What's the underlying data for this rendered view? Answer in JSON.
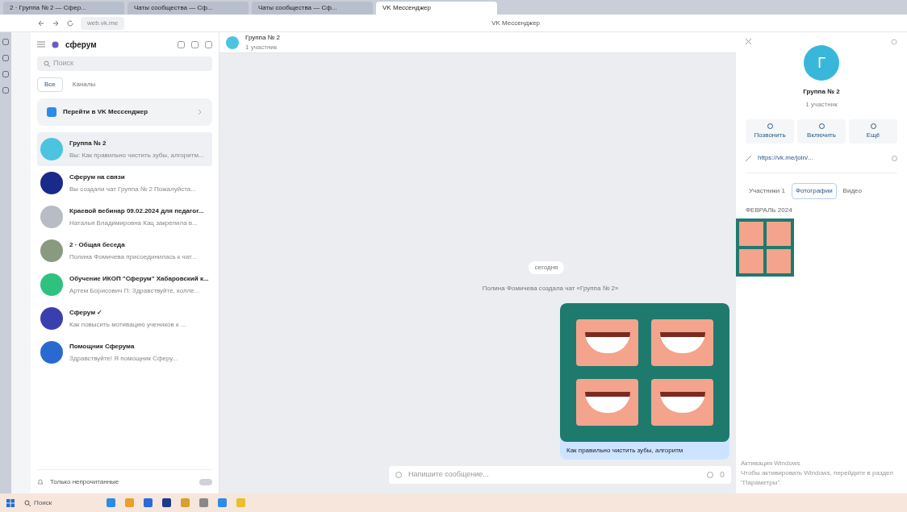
{
  "browser": {
    "tabs": [
      {
        "label": "2 · Группа № 2 — Сфер...",
        "selected": false
      },
      {
        "label": "Чаты сообщества — Сф...",
        "selected": false
      },
      {
        "label": "Чаты сообщества — Сф...",
        "selected": false
      },
      {
        "label": "VK Мессенджер",
        "selected": true
      }
    ],
    "address": "web.vk.me",
    "page_title": "VK Мессенджер"
  },
  "sidebar": {
    "account": "сферум",
    "search": {
      "placeholder": "Поиск"
    },
    "filters": [
      {
        "label": "Все",
        "selected": true
      },
      {
        "label": "Каналы",
        "selected": false
      }
    ],
    "promo": "Перейти в VK Мессенджер",
    "chats": [
      {
        "title": "Группа № 2",
        "preview": "Вы: Как правильно чистить зубы, алгоритм...",
        "color": "#4cc4e0",
        "selected": true
      },
      {
        "title": "Сферум на связи",
        "preview": "Вы создали чат Группа № 2 Пожалуйста...",
        "color": "#1a2a8a",
        "selected": false
      },
      {
        "title": "Краевой вебинар 09.02.2024 для педагог...",
        "preview": "Наталья Владимировна Кац закрепила в...",
        "color": "#b8bcc4",
        "selected": false
      },
      {
        "title": "2 · Общая беседа",
        "preview": "Полина Фомичева присоединилась к чат...",
        "color": "#8a9a80",
        "selected": false
      },
      {
        "title": "Обучение ИКОП \"Сферум\" Хабаровский к...",
        "preview": "Артем Борисович П: Здравствуйте, колле...",
        "color": "#2ec27e",
        "selected": false
      },
      {
        "title": "Сферум ✓",
        "preview": "Как повысить мотивацию учеников к ...",
        "color": "#3a3fb0",
        "selected": false
      },
      {
        "title": "Помощник Сферума",
        "preview": "Здравствуйте! Я помощник Сферу...",
        "color": "#2a6ad0",
        "selected": false
      }
    ],
    "unread_only": {
      "label": "Только непрочитанные",
      "on": false
    }
  },
  "chat": {
    "title": "Группа № 2",
    "subtitle": "1 участник",
    "date": "сегодня",
    "service": "Полина Фомичева создала чат «Группа № 2»",
    "message": {
      "caption": "Как правильно чистить зубы, алгоритм"
    },
    "input": {
      "placeholder": "Напишите сообщение..."
    }
  },
  "info": {
    "avatar_letter": "Г",
    "title": "Группа № 2",
    "subtitle": "1 участник",
    "actions": [
      "Позвонить",
      "Включить",
      "Ещё"
    ],
    "link": "https://vk.me/join/...",
    "tabs": [
      {
        "label": "Участники 1",
        "selected": false
      },
      {
        "label": "Фотографии",
        "selected": true
      },
      {
        "label": "Видео",
        "selected": false
      }
    ],
    "month": "ФЕВРАЛЬ 2024"
  },
  "os": {
    "activation_title": "Активация Windows",
    "activation_text": "Чтобы активировать Windows, перейдите в раздел \"Параметры\".",
    "search": "Поиск"
  }
}
